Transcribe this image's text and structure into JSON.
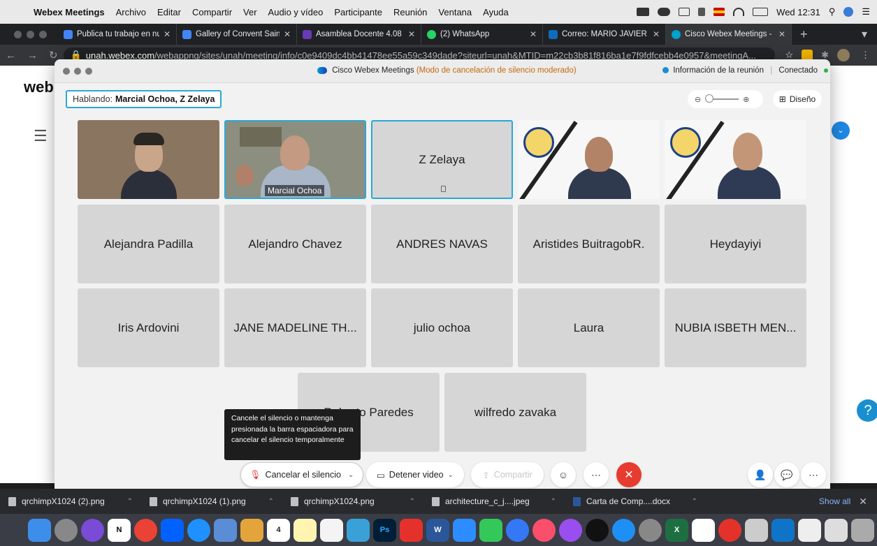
{
  "menubar": {
    "apple": "",
    "app": "Webex Meetings",
    "items": [
      "Archivo",
      "Editar",
      "Compartir",
      "Ver",
      "Audio y vídeo",
      "Participante",
      "Reunión",
      "Ventana",
      "Ayuda"
    ],
    "clock": "Wed 12:31"
  },
  "browser": {
    "tabs": [
      {
        "title": "Publica tu trabajo en nue",
        "color": "#4285f4"
      },
      {
        "title": "Gallery of Convent Saint",
        "color": "#4285f4"
      },
      {
        "title": "Asamblea Docente 4.08",
        "color": "#673ab7"
      },
      {
        "title": "(2) WhatsApp",
        "color": "#25d366"
      },
      {
        "title": "Correo: MARIO JAVIER M",
        "color": "#0f6cbd"
      },
      {
        "title": "Cisco Webex Meetings -",
        "color": "#00a0d1"
      }
    ],
    "new_tab": "+",
    "url_host": "unah.webex.com",
    "url_rest": "/webappng/sites/unah/meeting/info/c0e9409dc4bb41478ee55a59c349dade?siteurl=unah&MTID=m22cb3b81f816ba1e7f9fdfcebb4e0957&meetingA..."
  },
  "page": {
    "logo": "web",
    "help": "?"
  },
  "webex": {
    "title": "Cisco Webex Meetings",
    "mode": "(Modo de cancelación de silencio moderado)",
    "info": "Información de la reunión",
    "status": "Conectado",
    "speaking_label": "Hablando:",
    "speaking_names": "Marcial Ochoa,  Z Zelaya",
    "layout": "Diseño",
    "tiles": [
      {
        "name": "",
        "video": true
      },
      {
        "name": "Marcial Ochoa",
        "video": true
      },
      {
        "name": "Z Zelaya",
        "video": false
      },
      {
        "name": "",
        "video": true
      },
      {
        "name": "",
        "video": true
      },
      {
        "name": "Alejandra Padilla"
      },
      {
        "name": "Alejandro Chavez"
      },
      {
        "name": "ANDRES NAVAS"
      },
      {
        "name": "Aristides BuitragobR."
      },
      {
        "name": "Heydayiyi"
      },
      {
        "name": "Iris Ardovini"
      },
      {
        "name": "JANE MADELINE TH..."
      },
      {
        "name": "julio ochoa"
      },
      {
        "name": "Laura"
      },
      {
        "name": "NUBIA ISBETH MEN..."
      },
      {
        "name": "Roberto Paredes"
      },
      {
        "name": "wilfredo zavaka"
      }
    ],
    "tooltip": "Cancele el silencio o mantenga presionada la barra espaciadora para cancelar el silencio temporalmente",
    "controls": {
      "unmute": "Cancelar el silencio",
      "video": "Detener video",
      "share": "Compartir"
    }
  },
  "downloads": [
    {
      "name": "qrchimpX1024 (2).png"
    },
    {
      "name": "qrchimpX1024 (1).png"
    },
    {
      "name": "qrchimpX1024.png"
    },
    {
      "name": "architecture_c_j....jpeg"
    },
    {
      "name": "Carta de Comp....docx"
    }
  ],
  "downloads_show_all": "Show all",
  "dock_calendar_day": "4",
  "colors": {
    "accent": "#29a8d6",
    "end_call": "#e63b2e",
    "mode_text": "#c4690a"
  }
}
